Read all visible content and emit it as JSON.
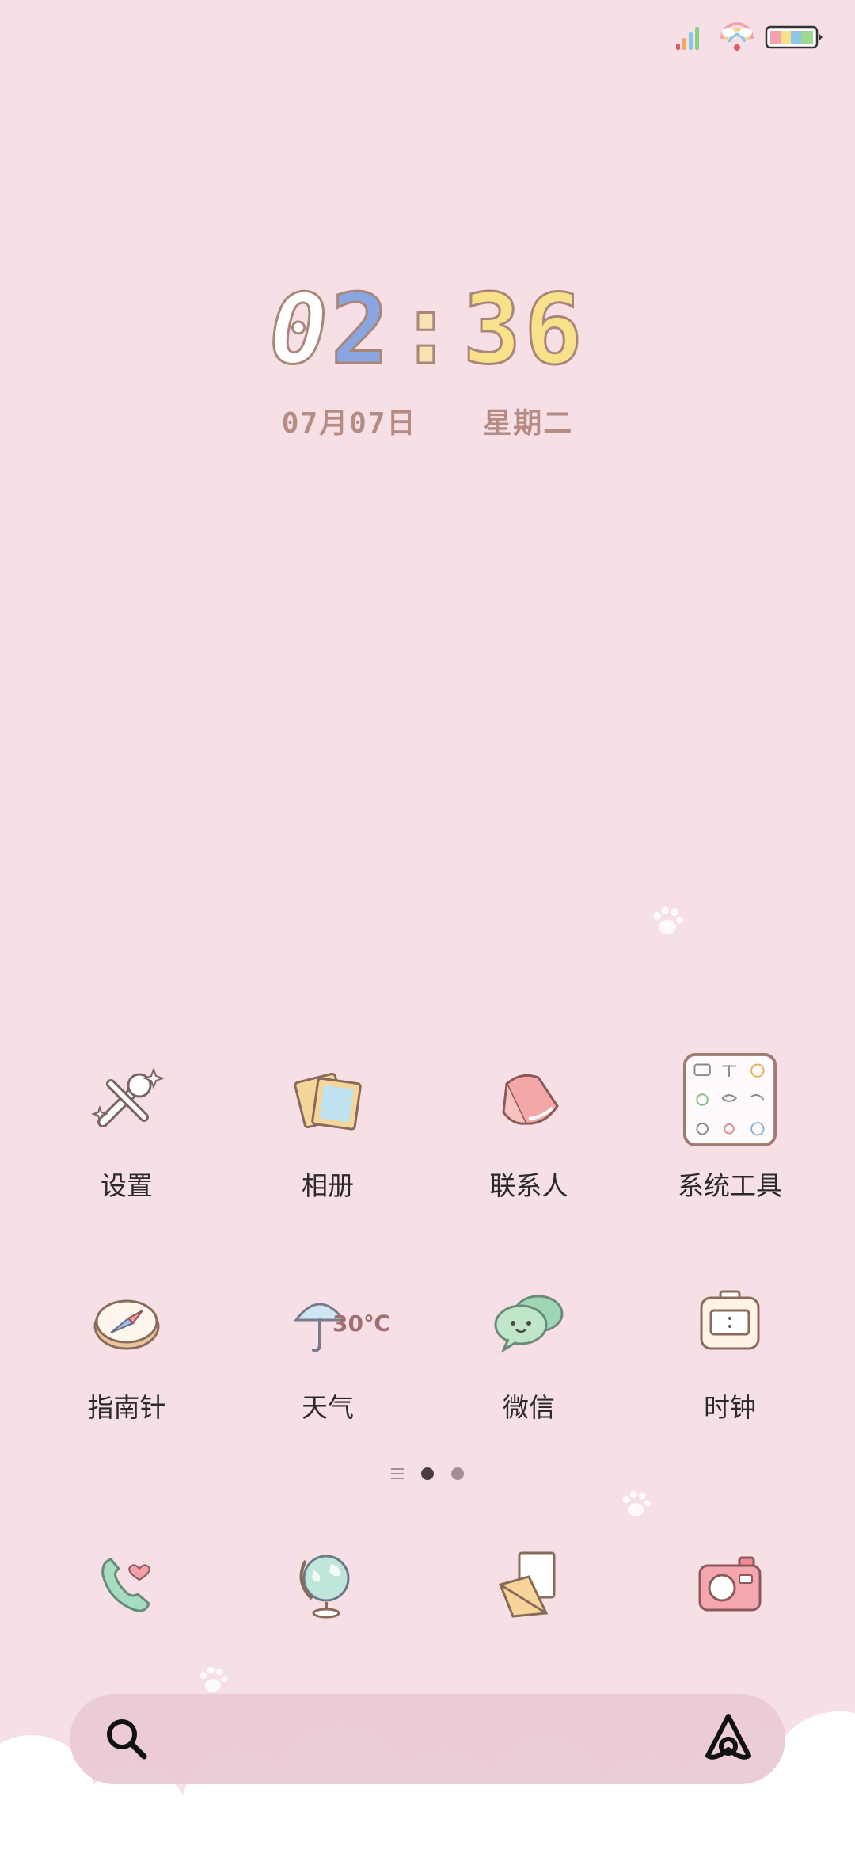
{
  "clock": {
    "d1": "0",
    "d2": "2",
    "colon": ":",
    "d3": "3",
    "d4": "6"
  },
  "date": {
    "day": "07月07日",
    "weekday": "星期二"
  },
  "apps_row1": [
    {
      "label": "设置",
      "icon": "settings-tools-icon"
    },
    {
      "label": "相册",
      "icon": "photo-album-icon"
    },
    {
      "label": "联系人",
      "icon": "contacts-book-icon"
    },
    {
      "label": "系统工具",
      "icon": "system-tools-folder-icon"
    }
  ],
  "apps_row2": [
    {
      "label": "指南针",
      "icon": "compass-icon"
    },
    {
      "label": "天气",
      "icon": "weather-umbrella-icon",
      "temp": "30℃"
    },
    {
      "label": "微信",
      "icon": "wechat-chat-icon"
    },
    {
      "label": "时钟",
      "icon": "clock-icon"
    }
  ],
  "pages": {
    "count": 2,
    "current": 1
  },
  "dock": [
    "phone-icon",
    "browser-globe-icon",
    "messages-envelope-icon",
    "camera-icon"
  ],
  "colors": {
    "background": "#f7dfe6",
    "digit_blue": "#8aa6e0",
    "digit_yellow": "#f9e08a",
    "date_text": "#b58c84"
  }
}
